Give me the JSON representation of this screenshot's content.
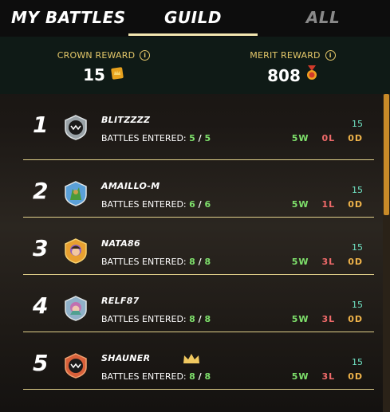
{
  "tabs": {
    "my_battles": "MY BATTLES",
    "guild": "GUILD",
    "all": "ALL"
  },
  "rewards": {
    "crown_label": "CROWN REWARD",
    "crown_value": "15",
    "merit_label": "MERIT REWARD",
    "merit_value": "808"
  },
  "players": [
    {
      "rank": "1",
      "name": "BLITZZZZ",
      "entered_label": "BATTLES ENTERED:",
      "entered": "5",
      "total": "5",
      "points": "15",
      "wins": "5W",
      "losses": "0L",
      "draws": "0D"
    },
    {
      "rank": "2",
      "name": "AMAILLO-M",
      "entered_label": "BATTLES ENTERED:",
      "entered": "6",
      "total": "6",
      "points": "15",
      "wins": "5W",
      "losses": "1L",
      "draws": "0D"
    },
    {
      "rank": "3",
      "name": "NATA86",
      "entered_label": "BATTLES ENTERED:",
      "entered": "8",
      "total": "8",
      "points": "15",
      "wins": "5W",
      "losses": "3L",
      "draws": "0D"
    },
    {
      "rank": "4",
      "name": "RELF87",
      "entered_label": "BATTLES ENTERED:",
      "entered": "8",
      "total": "8",
      "points": "15",
      "wins": "5W",
      "losses": "3L",
      "draws": "0D"
    },
    {
      "rank": "5",
      "name": "SHAUNER",
      "entered_label": "BATTLES ENTERED:",
      "entered": "8",
      "total": "8",
      "points": "15",
      "wins": "5W",
      "losses": "3L",
      "draws": "0D"
    }
  ],
  "colors": {
    "accent_gold": "#e6c96a",
    "win_green": "#7ee06b",
    "loss_red": "#f06a6a",
    "draw_orange": "#f0b44a",
    "points_teal": "#6fe1c2"
  },
  "icons": {
    "crown_reward": "crown-token-icon",
    "merit_reward": "merit-medal-icon",
    "leader": "crown-icon"
  }
}
